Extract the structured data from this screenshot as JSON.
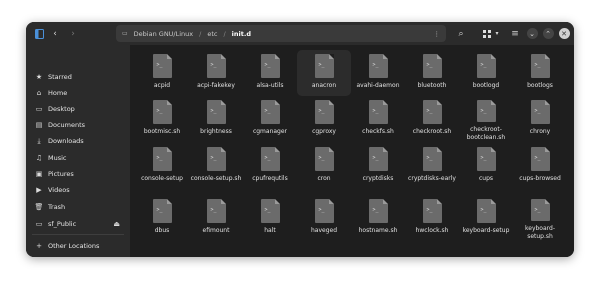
{
  "path": [
    "Debian GNU/Linux",
    "etc",
    "init.d"
  ],
  "sidebar": {
    "items": [
      {
        "label": "Starred",
        "icon": "star-icon"
      },
      {
        "label": "Home",
        "icon": "home-icon"
      },
      {
        "label": "Desktop",
        "icon": "desktop-icon"
      },
      {
        "label": "Documents",
        "icon": "documents-icon"
      },
      {
        "label": "Downloads",
        "icon": "downloads-icon"
      },
      {
        "label": "Music",
        "icon": "music-icon"
      },
      {
        "label": "Pictures",
        "icon": "pictures-icon"
      },
      {
        "label": "Videos",
        "icon": "videos-icon"
      },
      {
        "label": "Trash",
        "icon": "trash-icon"
      },
      {
        "label": "sf_Public",
        "icon": "drive-icon"
      }
    ],
    "other_locations": "Other Locations"
  },
  "files": [
    [
      "acpid",
      "acpi-fakekey",
      "alsa-utils",
      "anacron",
      "avahi-daemon",
      "bluetooth",
      "bootlogd",
      "bootlogs"
    ],
    [
      "bootmisc.sh",
      "brightness",
      "cgmanager",
      "cgproxy",
      "checkfs.sh",
      "checkroot.sh",
      "checkroot-bootclean.sh",
      "chrony"
    ],
    [
      "console-setup",
      "console-setup.sh",
      "cpufrequtils",
      "cron",
      "cryptdisks",
      "cryptdisks-early",
      "cups",
      "cups-browsed"
    ],
    [
      "dbus",
      "efimount",
      "halt",
      "haveged",
      "hostname.sh",
      "hwclock.sh",
      "keyboard-setup",
      "keyboard-setup.sh"
    ]
  ]
}
